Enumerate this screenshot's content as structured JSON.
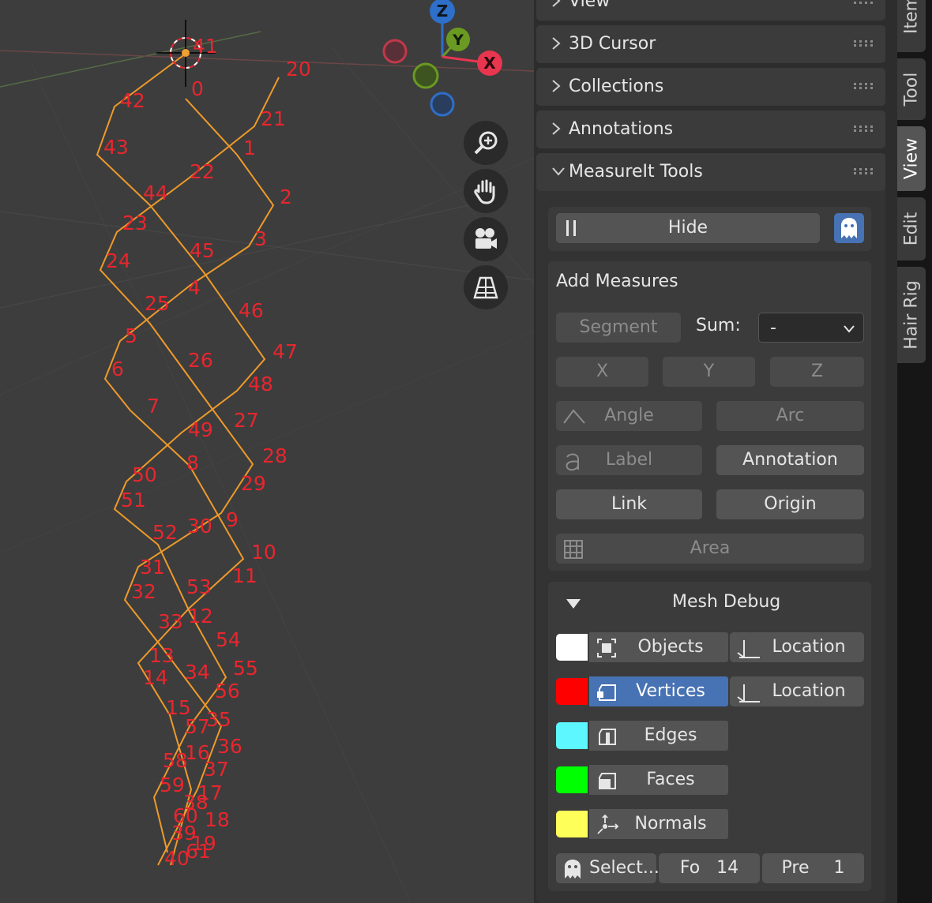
{
  "viewport": {
    "vertex_labels": [
      {
        "text": "41"
      },
      {
        "text": "20"
      },
      {
        "text": "0"
      },
      {
        "text": "42"
      },
      {
        "text": "21"
      },
      {
        "text": "1"
      },
      {
        "text": "43"
      },
      {
        "text": "22"
      },
      {
        "text": "44"
      },
      {
        "text": "2"
      },
      {
        "text": "23"
      },
      {
        "text": "3"
      },
      {
        "text": "24"
      },
      {
        "text": "45"
      },
      {
        "text": "4"
      },
      {
        "text": "25"
      },
      {
        "text": "46"
      },
      {
        "text": "5"
      },
      {
        "text": "47"
      },
      {
        "text": "6"
      },
      {
        "text": "26"
      },
      {
        "text": "48"
      },
      {
        "text": "7"
      },
      {
        "text": "27"
      },
      {
        "text": "49"
      },
      {
        "text": "28"
      },
      {
        "text": "8"
      },
      {
        "text": "50"
      },
      {
        "text": "29"
      },
      {
        "text": "51"
      },
      {
        "text": "9"
      },
      {
        "text": "30"
      },
      {
        "text": "52"
      },
      {
        "text": "10"
      },
      {
        "text": "31"
      },
      {
        "text": "11"
      },
      {
        "text": "53"
      },
      {
        "text": "32"
      },
      {
        "text": "12"
      },
      {
        "text": "33"
      },
      {
        "text": "54"
      },
      {
        "text": "13"
      },
      {
        "text": "55"
      },
      {
        "text": "34"
      },
      {
        "text": "14"
      },
      {
        "text": "56"
      },
      {
        "text": "15"
      },
      {
        "text": "35"
      },
      {
        "text": "57"
      },
      {
        "text": "36"
      },
      {
        "text": "16"
      },
      {
        "text": "58"
      },
      {
        "text": "37"
      },
      {
        "text": "59"
      },
      {
        "text": "17"
      },
      {
        "text": "38"
      },
      {
        "text": "60"
      },
      {
        "text": "18"
      },
      {
        "text": "39"
      },
      {
        "text": "19"
      },
      {
        "text": "61"
      },
      {
        "text": "40"
      }
    ],
    "gizmo": {
      "z": "Z",
      "y": "Y",
      "x": "X"
    },
    "nav_buttons": [
      "zoom-icon",
      "hand-pan-icon",
      "camera-icon",
      "grid-perspective-icon"
    ],
    "colors": {
      "mesh_edge": "#ee9a2a",
      "vertex_label": "#e8262e",
      "axis_x": "#e8364f",
      "axis_y": "#6a9a22",
      "axis_z": "#2d6fc9"
    }
  },
  "panel": {
    "headers": {
      "view": "View",
      "cursor": "3D Cursor",
      "collections": "Collections",
      "annotations": "Annotations",
      "measureit": "MeasureIt Tools"
    },
    "hide_label": "Hide",
    "add_measures": {
      "title": "Add Measures",
      "segment": "Segment",
      "sum_label": "Sum:",
      "sum_value": "-",
      "x": "X",
      "y": "Y",
      "z": "Z",
      "angle": "Angle",
      "arc": "Arc",
      "label": "Label",
      "annotation": "Annotation",
      "link": "Link",
      "origin": "Origin",
      "area": "Area"
    },
    "mesh_debug": {
      "title": "Mesh Debug",
      "rows": [
        {
          "label": "Objects",
          "color": "#ffffff",
          "loc": "Location"
        },
        {
          "label": "Vertices",
          "color": "#ff0000",
          "loc": "Location"
        },
        {
          "label": "Edges",
          "color": "#5cf7ff"
        },
        {
          "label": "Faces",
          "color": "#00ff00"
        },
        {
          "label": "Normals",
          "color": "#ffff59"
        }
      ],
      "select_label": "Select...",
      "font_label": "Fo",
      "font_value": "14",
      "precision_label": "Pre",
      "precision_value": "1"
    }
  },
  "tabs": [
    "Item",
    "Tool",
    "View",
    "Edit",
    "Hair Rig"
  ]
}
